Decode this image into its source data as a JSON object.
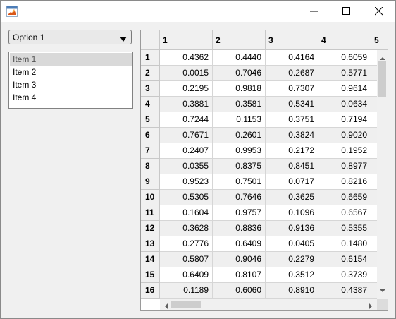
{
  "window": {
    "icon": "matlab-icon",
    "controls": [
      "minimize-icon",
      "maximize-icon",
      "close-icon"
    ]
  },
  "dropdown": {
    "selected": "Option 1",
    "icon": "triangle-down-icon"
  },
  "listbox": {
    "items": [
      "Item 1",
      "Item 2",
      "Item 3",
      "Item 4"
    ],
    "selected_index": 0
  },
  "table": {
    "column_headers": [
      "1",
      "2",
      "3",
      "4",
      "5"
    ],
    "row_headers": [
      "1",
      "2",
      "3",
      "4",
      "5",
      "6",
      "7",
      "8",
      "9",
      "10",
      "11",
      "12",
      "13",
      "14",
      "15",
      "16"
    ],
    "rows": [
      [
        "0.4362",
        "0.4440",
        "0.4164",
        "0.6059"
      ],
      [
        "0.0015",
        "0.7046",
        "0.2687",
        "0.5771"
      ],
      [
        "0.2195",
        "0.9818",
        "0.7307",
        "0.9614"
      ],
      [
        "0.3881",
        "0.3581",
        "0.5341",
        "0.0634"
      ],
      [
        "0.7244",
        "0.1153",
        "0.3751",
        "0.7194"
      ],
      [
        "0.7671",
        "0.2601",
        "0.3824",
        "0.9020"
      ],
      [
        "0.2407",
        "0.9953",
        "0.2172",
        "0.1952"
      ],
      [
        "0.0355",
        "0.8375",
        "0.8451",
        "0.8977"
      ],
      [
        "0.9523",
        "0.7501",
        "0.0717",
        "0.8216"
      ],
      [
        "0.5305",
        "0.7646",
        "0.3625",
        "0.6659"
      ],
      [
        "0.1604",
        "0.9757",
        "0.1096",
        "0.6567"
      ],
      [
        "0.3628",
        "0.8836",
        "0.9136",
        "0.5355"
      ],
      [
        "0.2776",
        "0.6409",
        "0.0405",
        "0.1480"
      ],
      [
        "0.5807",
        "0.9046",
        "0.2279",
        "0.6154"
      ],
      [
        "0.6409",
        "0.8107",
        "0.3512",
        "0.3739"
      ],
      [
        "0.1189",
        "0.6060",
        "0.8910",
        "0.4387"
      ]
    ],
    "vertical_scroll_fraction": 0.0,
    "horizontal_scroll_fraction": 0.0
  }
}
